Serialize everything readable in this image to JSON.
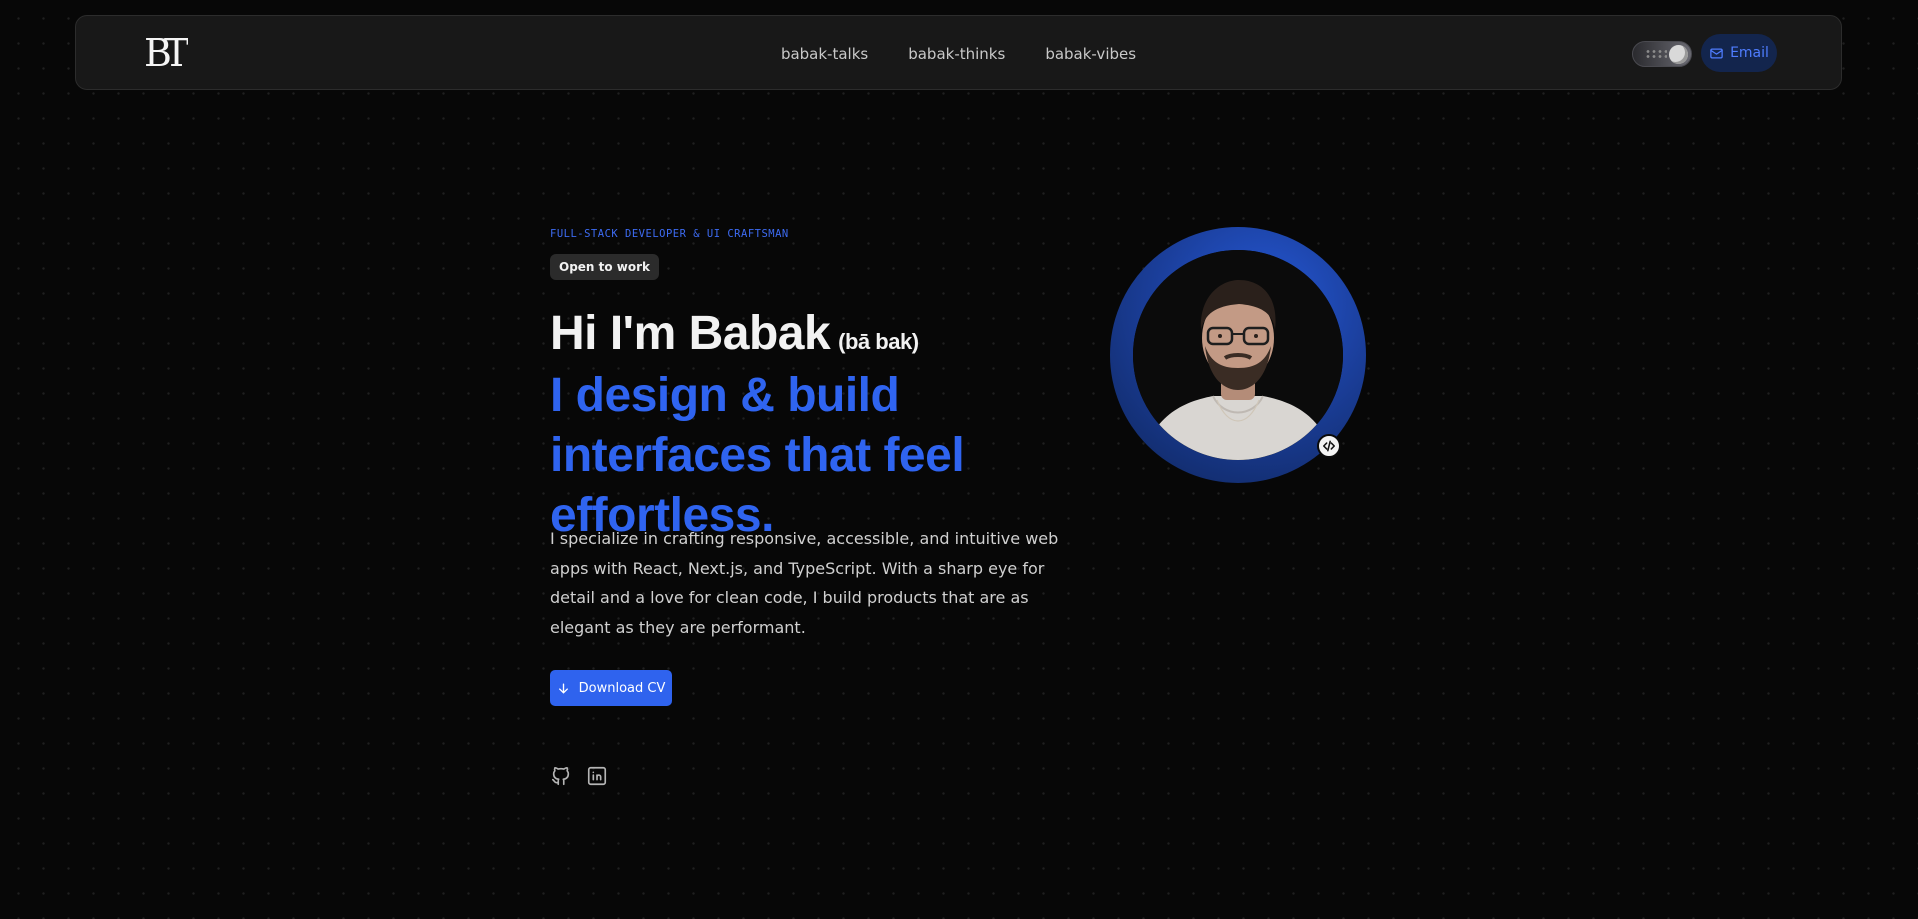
{
  "nav": {
    "logo_text": "BT",
    "links": [
      "babak-talks",
      "babak-thinks",
      "babak-vibes"
    ],
    "email_label": "Email"
  },
  "hero": {
    "eyebrow": "FULL-STACK DEVELOPER & UI CRAFTSMAN",
    "badge": "Open to work",
    "greeting": "Hi I'm Babak",
    "pronunciation": "(bā bak)",
    "tagline": "I design & build interfaces that feel effortless.",
    "description": "I specialize in crafting responsive, accessible, and intuitive web apps with React, Next.js, and TypeScript. With a sharp eye for detail and a love for clean code, I build products that are as elegant as they are performant.",
    "cta_label": "Download CV"
  },
  "socials": [
    "github-icon",
    "linkedin-icon"
  ],
  "colors": {
    "accent": "#2f64f0",
    "background": "#070707",
    "nav_bg": "#181818",
    "email_bg": "#13254d"
  }
}
